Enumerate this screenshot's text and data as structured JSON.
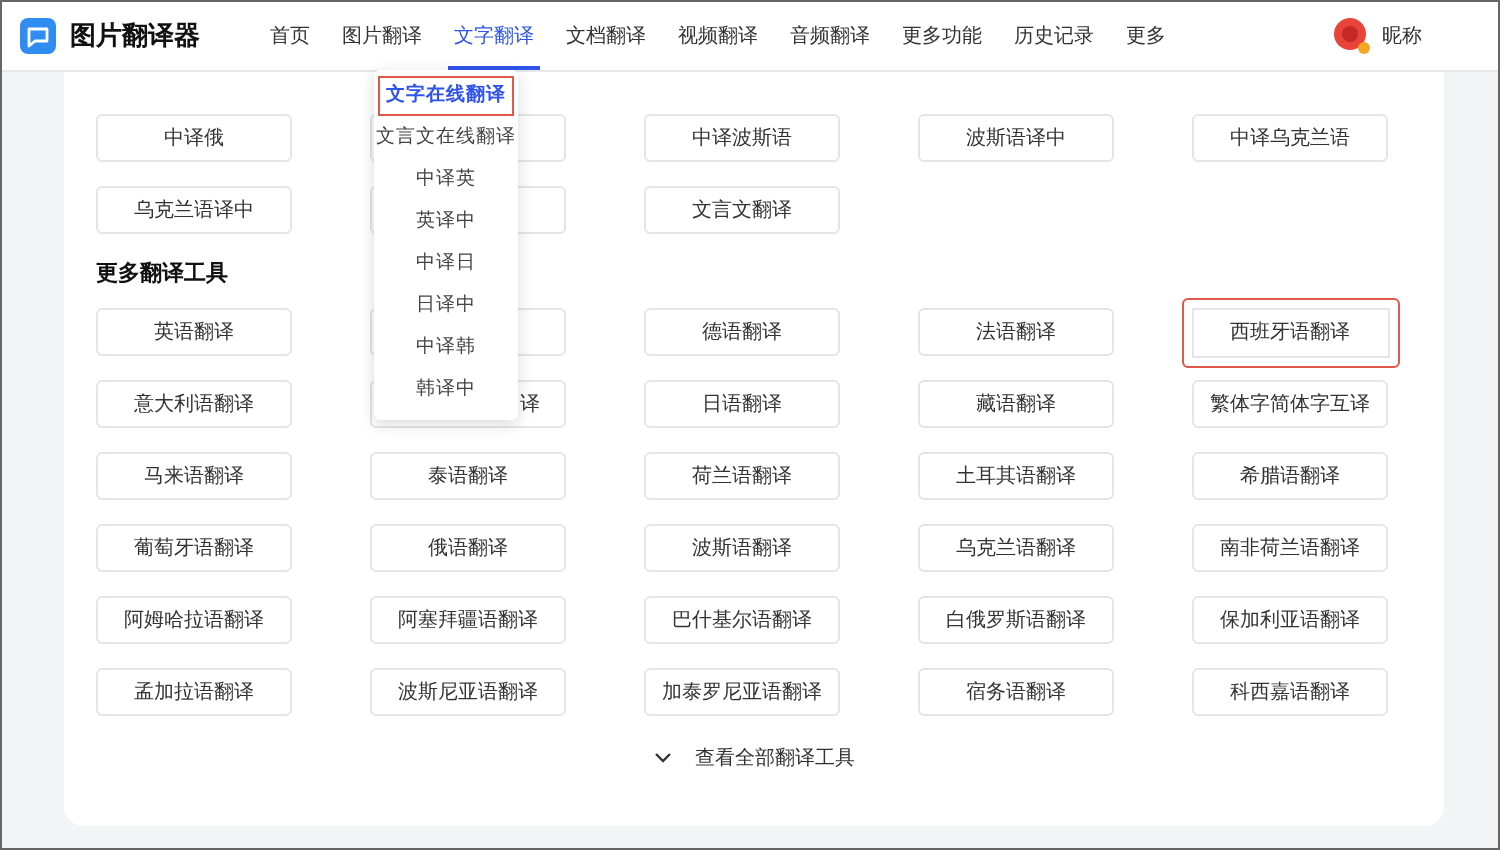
{
  "header": {
    "app_name": "图片翻译器",
    "nav": [
      {
        "label": "首页",
        "selected": false
      },
      {
        "label": "图片翻译",
        "selected": false
      },
      {
        "label": "文字翻译",
        "selected": true
      },
      {
        "label": "文档翻译",
        "selected": false
      },
      {
        "label": "视频翻译",
        "selected": false
      },
      {
        "label": "音频翻译",
        "selected": false
      },
      {
        "label": "更多功能",
        "selected": false
      },
      {
        "label": "历史记录",
        "selected": false
      },
      {
        "label": "更多",
        "selected": false
      }
    ],
    "user": {
      "name": "昵称"
    }
  },
  "dropdown": {
    "items": [
      {
        "label": "文字在线翻译",
        "selected": true
      },
      {
        "label": "文言文在线翻译",
        "selected": false
      },
      {
        "label": "中译英",
        "selected": false
      },
      {
        "label": "英译中",
        "selected": false
      },
      {
        "label": "中译日",
        "selected": false
      },
      {
        "label": "日译中",
        "selected": false
      },
      {
        "label": "中译韩",
        "selected": false
      },
      {
        "label": "韩译中",
        "selected": false
      }
    ]
  },
  "quick_tools": [
    {
      "kind": "full",
      "label": "中译俄"
    },
    {
      "kind": "covered"
    },
    {
      "kind": "full",
      "label": "中译波斯语"
    },
    {
      "kind": "full",
      "label": "波斯语译中"
    },
    {
      "kind": "full",
      "label": "中译乌克兰语"
    },
    {
      "kind": "full",
      "label": "乌克兰语译中"
    },
    {
      "kind": "covered"
    },
    {
      "kind": "full",
      "label": "文言文翻译"
    }
  ],
  "more_tools": {
    "title": "更多翻译工具",
    "items": [
      {
        "kind": "full",
        "label": "英语翻译",
        "highlighted": false
      },
      {
        "kind": "covered"
      },
      {
        "kind": "full",
        "label": "德语翻译",
        "highlighted": false
      },
      {
        "kind": "full",
        "label": "法语翻译",
        "highlighted": false
      },
      {
        "kind": "full",
        "label": "西班牙语翻译",
        "highlighted": true
      },
      {
        "kind": "full",
        "label": "意大利语翻译",
        "highlighted": false
      },
      {
        "kind": "partial",
        "label": "译",
        "highlighted": false
      },
      {
        "kind": "full",
        "label": "日语翻译",
        "highlighted": false
      },
      {
        "kind": "full",
        "label": "藏语翻译",
        "highlighted": false
      },
      {
        "kind": "full",
        "label": "繁体字简体字互译",
        "highlighted": false
      },
      {
        "kind": "full",
        "label": "马来语翻译",
        "highlighted": false
      },
      {
        "kind": "full",
        "label": "泰语翻译",
        "highlighted": false
      },
      {
        "kind": "full",
        "label": "荷兰语翻译",
        "highlighted": false
      },
      {
        "kind": "full",
        "label": "土耳其语翻译",
        "highlighted": false
      },
      {
        "kind": "full",
        "label": "希腊语翻译",
        "highlighted": false
      },
      {
        "kind": "full",
        "label": "葡萄牙语翻译",
        "highlighted": false
      },
      {
        "kind": "full",
        "label": "俄语翻译",
        "highlighted": false
      },
      {
        "kind": "full",
        "label": "波斯语翻译",
        "highlighted": false
      },
      {
        "kind": "full",
        "label": "乌克兰语翻译",
        "highlighted": false
      },
      {
        "kind": "full",
        "label": "南非荷兰语翻译",
        "highlighted": false
      },
      {
        "kind": "full",
        "label": "阿姆哈拉语翻译",
        "highlighted": false
      },
      {
        "kind": "full",
        "label": "阿塞拜疆语翻译",
        "highlighted": false
      },
      {
        "kind": "full",
        "label": "巴什基尔语翻译",
        "highlighted": false
      },
      {
        "kind": "full",
        "label": "白俄罗斯语翻译",
        "highlighted": false
      },
      {
        "kind": "full",
        "label": "保加利亚语翻译",
        "highlighted": false
      },
      {
        "kind": "full",
        "label": "孟加拉语翻译",
        "highlighted": false
      },
      {
        "kind": "full",
        "label": "波斯尼亚语翻译",
        "highlighted": false
      },
      {
        "kind": "full",
        "label": "加泰罗尼亚语翻译",
        "highlighted": false
      },
      {
        "kind": "full",
        "label": "宿务语翻译",
        "highlighted": false
      },
      {
        "kind": "full",
        "label": "科西嘉语翻译",
        "highlighted": false
      }
    ],
    "show_all": "查看全部翻译工具"
  }
}
